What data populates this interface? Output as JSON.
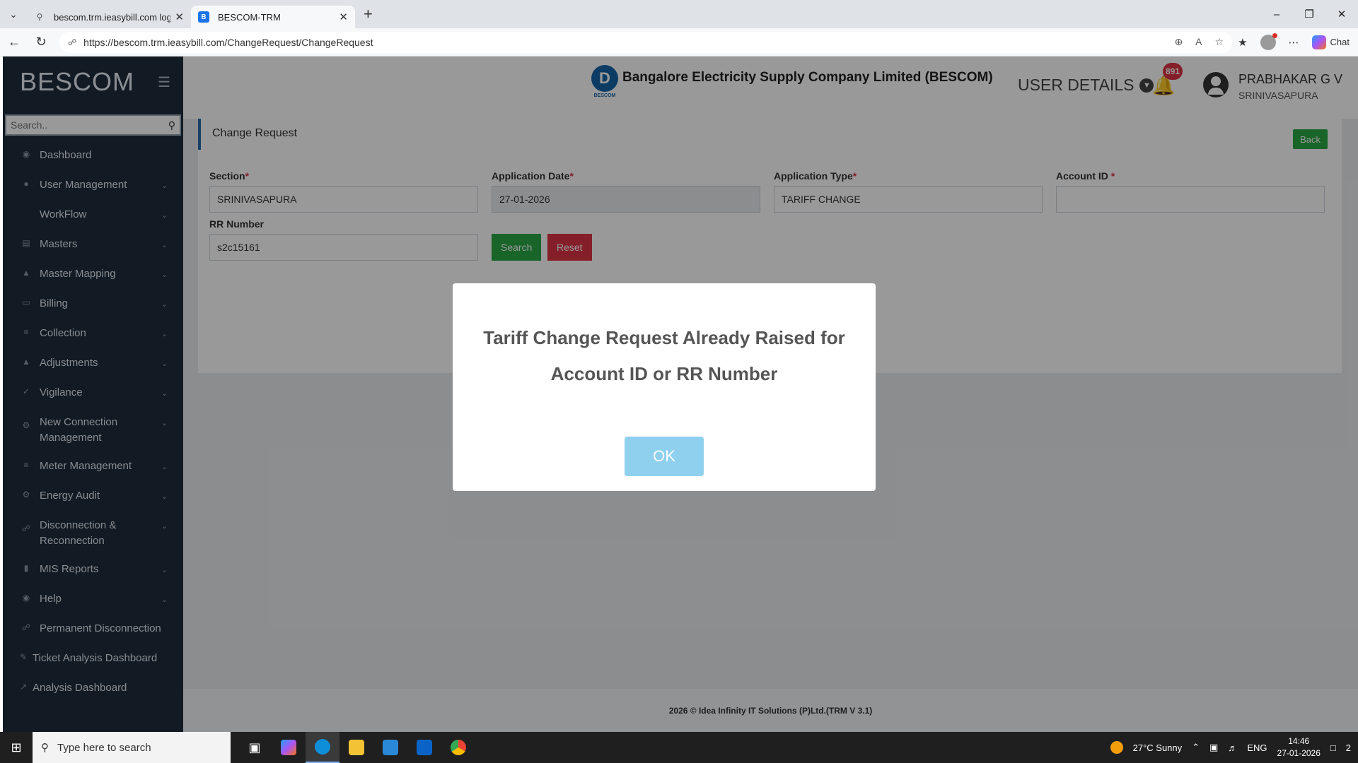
{
  "browser": {
    "tabs": [
      {
        "title": "bescom.trm.ieasybill.com login - S",
        "active": false
      },
      {
        "title": "BESCOM-TRM",
        "active": true
      }
    ],
    "url": "https://bescom.trm.ieasybill.com/ChangeRequest/ChangeRequest",
    "chat_label": "Chat"
  },
  "sidebar": {
    "brand": "BESCOM",
    "search_placeholder": "Search..",
    "items": [
      {
        "label": "Dashboard",
        "icon": "dashboard-icon",
        "chevron": false
      },
      {
        "label": "User Management",
        "icon": "user-icon",
        "chevron": true
      },
      {
        "label": "WorkFlow",
        "icon": "workflow-icon",
        "chevron": true
      },
      {
        "label": "Masters",
        "icon": "masters-icon",
        "chevron": true
      },
      {
        "label": "Master Mapping",
        "icon": "mapping-icon",
        "chevron": true
      },
      {
        "label": "Billing",
        "icon": "billing-icon",
        "chevron": true
      },
      {
        "label": "Collection",
        "icon": "collection-icon",
        "chevron": true
      },
      {
        "label": "Adjustments",
        "icon": "adjustments-icon",
        "chevron": true
      },
      {
        "label": "Vigilance",
        "icon": "vigilance-icon",
        "chevron": true
      },
      {
        "label": "New Connection Management",
        "icon": "connection-icon",
        "chevron": true
      },
      {
        "label": "Meter Management",
        "icon": "meter-icon",
        "chevron": true
      },
      {
        "label": "Energy Audit",
        "icon": "audit-icon",
        "chevron": true
      },
      {
        "label": "Disconnection & Reconnection",
        "icon": "disconnection-icon",
        "chevron": true
      },
      {
        "label": "MIS Reports",
        "icon": "reports-icon",
        "chevron": true
      },
      {
        "label": "Help",
        "icon": "help-icon",
        "chevron": true
      },
      {
        "label": "Permanent Disconnection",
        "icon": "permanent-disconnection-icon",
        "chevron": false
      },
      {
        "label": "Ticket Analysis Dashboard",
        "icon": "ticket-icon",
        "chevron": false
      },
      {
        "label": "Analysis Dashboard",
        "icon": "analysis-icon",
        "chevron": false
      }
    ]
  },
  "header": {
    "company": "Bangalore Electricity Supply Company Limited (BESCOM)",
    "logo_text": "BESCOM",
    "user_details": "USER DETAILS",
    "notification_count": "891",
    "user_name": "PRABHAKAR G V",
    "user_location": "SRINIVASAPURA"
  },
  "form": {
    "title": "Change Request",
    "back_label": "Back",
    "section_label": "Section",
    "section_value": "SRINIVASAPURA",
    "app_date_label": "Application Date",
    "app_date_value": "27-01-2026",
    "app_type_label": "Application Type",
    "app_type_value": "TARIFF CHANGE",
    "account_id_label": "Account ID",
    "account_id_value": "",
    "rr_label": "RR Number",
    "rr_value": "s2c15161",
    "search_label": "Search",
    "reset_label": "Reset"
  },
  "footer": {
    "text": "2026 © Idea Infinity IT Solutions (P)Ltd.(TRM V 3.1)"
  },
  "modal": {
    "message": "Tariff Change Request Already Raised for Account ID or RR Number",
    "ok_label": "OK"
  },
  "taskbar": {
    "search_placeholder": "Type here to search",
    "weather": "27°C  Sunny",
    "language": "ENG",
    "time": "14:46",
    "date": "27-01-2026",
    "notification_count": "2"
  },
  "colors": {
    "sidebar_bg": "#1f2d3d",
    "accent_blue": "#2a6aa8",
    "success": "#28a745",
    "danger": "#dc3545",
    "ok_button": "#8fd0ee"
  }
}
